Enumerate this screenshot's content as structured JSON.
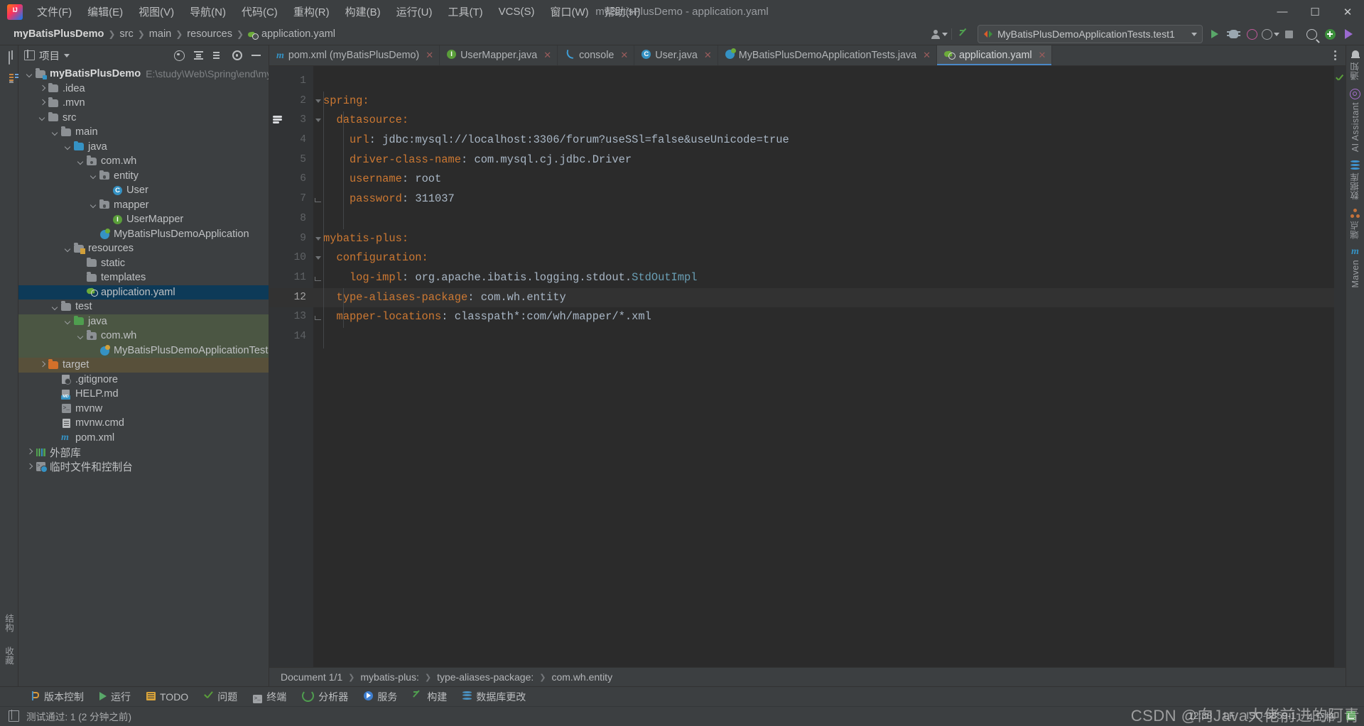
{
  "window": {
    "title": "myBatisPlusDemo - application.yaml",
    "logo": "intellij-idea-logo"
  },
  "menu": [
    {
      "label": "文件(F)"
    },
    {
      "label": "编辑(E)"
    },
    {
      "label": "视图(V)"
    },
    {
      "label": "导航(N)"
    },
    {
      "label": "代码(C)"
    },
    {
      "label": "重构(R)"
    },
    {
      "label": "构建(B)"
    },
    {
      "label": "运行(U)"
    },
    {
      "label": "工具(T)"
    },
    {
      "label": "VCS(S)"
    },
    {
      "label": "窗口(W)"
    },
    {
      "label": "帮助(H)"
    }
  ],
  "window_controls": {
    "minimize": "—",
    "maximize": "☐",
    "close": "✕"
  },
  "navbar": {
    "crumbs": [
      "myBatisPlusDemo",
      "src",
      "main",
      "resources",
      "application.yaml"
    ],
    "run_config": "MyBatisPlusDemoApplicationTests.test1",
    "actions": [
      "run",
      "debug",
      "run-with-coverage",
      "more-run-options",
      "stop",
      "search",
      "add",
      "run-anything"
    ]
  },
  "left_strip": {
    "top": [
      "project-icon",
      "structure-icon",
      "folder-icon"
    ],
    "bottom_labels": [
      "结构",
      "收藏"
    ],
    "bookmark": "bookmark-icon"
  },
  "project_panel": {
    "title": "项目",
    "actions": [
      "locate-target",
      "collapse-all",
      "sort-alpha",
      "settings",
      "hide"
    ],
    "tree": [
      {
        "label": "myBatisPlusDemo",
        "path": "E:\\study\\Web\\Spring\\end\\myBat",
        "indent": 0,
        "arrow": "open",
        "icon": "module-folder",
        "bold": true
      },
      {
        "label": ".idea",
        "indent": 1,
        "arrow": "closed",
        "icon": "folder"
      },
      {
        "label": ".mvn",
        "indent": 1,
        "arrow": "closed",
        "icon": "folder"
      },
      {
        "label": "src",
        "indent": 1,
        "arrow": "open",
        "icon": "folder"
      },
      {
        "label": "main",
        "indent": 2,
        "arrow": "open",
        "icon": "folder"
      },
      {
        "label": "java",
        "indent": 3,
        "arrow": "open",
        "icon": "source-folder"
      },
      {
        "label": "com.wh",
        "indent": 4,
        "arrow": "open",
        "icon": "package"
      },
      {
        "label": "entity",
        "indent": 5,
        "arrow": "open",
        "icon": "package"
      },
      {
        "label": "User",
        "indent": 6,
        "arrow": "none",
        "icon": "java-class"
      },
      {
        "label": "mapper",
        "indent": 5,
        "arrow": "open",
        "icon": "package"
      },
      {
        "label": "UserMapper",
        "indent": 6,
        "arrow": "none",
        "icon": "java-interface"
      },
      {
        "label": "MyBatisPlusDemoApplication",
        "indent": 5,
        "arrow": "none",
        "icon": "spring-boot-class"
      },
      {
        "label": "resources",
        "indent": 3,
        "arrow": "open",
        "icon": "resources-folder"
      },
      {
        "label": "static",
        "indent": 4,
        "arrow": "none",
        "icon": "folder"
      },
      {
        "label": "templates",
        "indent": 4,
        "arrow": "none",
        "icon": "folder"
      },
      {
        "label": "application.yaml",
        "indent": 4,
        "arrow": "none",
        "icon": "spring-yaml",
        "selected": true
      },
      {
        "label": "test",
        "indent": 2,
        "arrow": "open",
        "icon": "folder"
      },
      {
        "label": "java",
        "indent": 3,
        "arrow": "open",
        "icon": "test-source-folder",
        "testroot": true
      },
      {
        "label": "com.wh",
        "indent": 4,
        "arrow": "open",
        "icon": "package",
        "testroot": true
      },
      {
        "label": "MyBatisPlusDemoApplicationTests",
        "indent": 5,
        "arrow": "none",
        "icon": "spring-test-class",
        "testroot": true
      },
      {
        "label": "target",
        "indent": 1,
        "arrow": "closed",
        "icon": "target-folder",
        "targetroot": true
      },
      {
        "label": ".gitignore",
        "indent": 2,
        "arrow": "none",
        "icon": "gitignore-file"
      },
      {
        "label": "HELP.md",
        "indent": 2,
        "arrow": "none",
        "icon": "markdown-file"
      },
      {
        "label": "mvnw",
        "indent": 2,
        "arrow": "none",
        "icon": "shell-file"
      },
      {
        "label": "mvnw.cmd",
        "indent": 2,
        "arrow": "none",
        "icon": "cmd-file"
      },
      {
        "label": "pom.xml",
        "indent": 2,
        "arrow": "none",
        "icon": "maven-file"
      },
      {
        "label": "外部库",
        "indent": 0,
        "arrow": "closed",
        "icon": "external-libraries"
      },
      {
        "label": "临时文件和控制台",
        "indent": 0,
        "arrow": "closed",
        "icon": "scratches-consoles"
      }
    ]
  },
  "editor": {
    "tabs": [
      {
        "label": "pom.xml (myBatisPlusDemo)",
        "icon": "maven-icon",
        "active": false
      },
      {
        "label": "UserMapper.java",
        "icon": "interface-icon",
        "active": false
      },
      {
        "label": "console",
        "icon": "mysql-dolphin-icon",
        "active": false
      },
      {
        "label": "User.java",
        "icon": "class-icon",
        "active": false
      },
      {
        "label": "MyBatisPlusDemoApplicationTests.java",
        "icon": "spring-class-icon",
        "active": false
      },
      {
        "label": "application.yaml",
        "icon": "spring-yaml-icon",
        "active": true
      }
    ],
    "lines": [
      {
        "n": "1",
        "segments": []
      },
      {
        "n": "2",
        "segments": [
          {
            "t": "spring:",
            "c": "k"
          }
        ],
        "indent": 0,
        "fold": "v"
      },
      {
        "n": "3",
        "segments": [
          {
            "t": "  datasource:",
            "c": "k"
          }
        ],
        "indent": 1,
        "fold": "v",
        "bean": true
      },
      {
        "n": "4",
        "segments": [
          {
            "t": "    url",
            "c": "k"
          },
          {
            "t": ": ",
            "c": "v"
          },
          {
            "t": "jdbc:mysql://localhost:3306/forum?useSSl=false&useUnicode=true",
            "c": "v"
          }
        ]
      },
      {
        "n": "5",
        "segments": [
          {
            "t": "    driver-class-name",
            "c": "k"
          },
          {
            "t": ": ",
            "c": "v"
          },
          {
            "t": "com.mysql.cj.jdbc.Driver",
            "c": "v"
          }
        ]
      },
      {
        "n": "6",
        "segments": [
          {
            "t": "    username",
            "c": "k"
          },
          {
            "t": ": ",
            "c": "v"
          },
          {
            "t": "root",
            "c": "v"
          }
        ]
      },
      {
        "n": "7",
        "segments": [
          {
            "t": "    password",
            "c": "k"
          },
          {
            "t": ": ",
            "c": "v"
          },
          {
            "t": "311037",
            "c": "v"
          }
        ],
        "fold": "end"
      },
      {
        "n": "8",
        "segments": []
      },
      {
        "n": "9",
        "segments": [
          {
            "t": "mybatis-plus:",
            "c": "k"
          }
        ],
        "fold": "v"
      },
      {
        "n": "10",
        "segments": [
          {
            "t": "  configuration:",
            "c": "k"
          }
        ],
        "fold": "v"
      },
      {
        "n": "11",
        "segments": [
          {
            "t": "    log-impl",
            "c": "k"
          },
          {
            "t": ": ",
            "c": "v"
          },
          {
            "t": "org.apache.ibatis.logging.stdout.",
            "c": "v"
          },
          {
            "t": "StdOutImpl",
            "c": "cls"
          }
        ],
        "fold": "end"
      },
      {
        "n": "12",
        "segments": [
          {
            "t": "  type-aliases-package",
            "c": "k"
          },
          {
            "t": ": ",
            "c": "v"
          },
          {
            "t": "com.wh.entity",
            "c": "v"
          }
        ],
        "current": true
      },
      {
        "n": "13",
        "segments": [
          {
            "t": "  mapper-locations",
            "c": "k"
          },
          {
            "t": ": ",
            "c": "v"
          },
          {
            "t": "classpath*:com/wh/mapper/*.xml",
            "c": "v"
          }
        ],
        "fold": "end"
      },
      {
        "n": "14",
        "segments": []
      }
    ],
    "breadcrumbs": [
      "Document 1/1",
      "mybatis-plus:",
      "type-aliases-package:",
      "com.wh.entity"
    ],
    "inspection_status": "no-problems-check"
  },
  "right_strip": [
    {
      "label": "通知",
      "icon": "bell-icon"
    },
    {
      "label": "AI Assistant",
      "icon": "at-icon"
    },
    {
      "label": "数据库",
      "icon": "database-icon"
    },
    {
      "label": "端点",
      "icon": "endpoints-icon"
    },
    {
      "label": "Maven",
      "icon": "maven-icon"
    }
  ],
  "bottom_bar": [
    {
      "label": "版本控制",
      "icon": "git-branch-icon"
    },
    {
      "label": "运行",
      "icon": "run-icon"
    },
    {
      "label": "TODO",
      "icon": "todo-icon"
    },
    {
      "label": "问题",
      "icon": "check-icon"
    },
    {
      "label": "终端",
      "icon": "terminal-icon"
    },
    {
      "label": "分析器",
      "icon": "profiler-icon"
    },
    {
      "label": "服务",
      "icon": "services-icon"
    },
    {
      "label": "构建",
      "icon": "build-icon"
    },
    {
      "label": "数据库更改",
      "icon": "db-changes-icon"
    }
  ],
  "status_bar": {
    "message": "测试通过: 1 (2 分钟之前)",
    "time": "12:38",
    "line_sep": "LF",
    "encoding": "ISO-8859-1",
    "indent": "4 空格",
    "watermark": "CSDN @向Java大佬前进的阿青"
  }
}
